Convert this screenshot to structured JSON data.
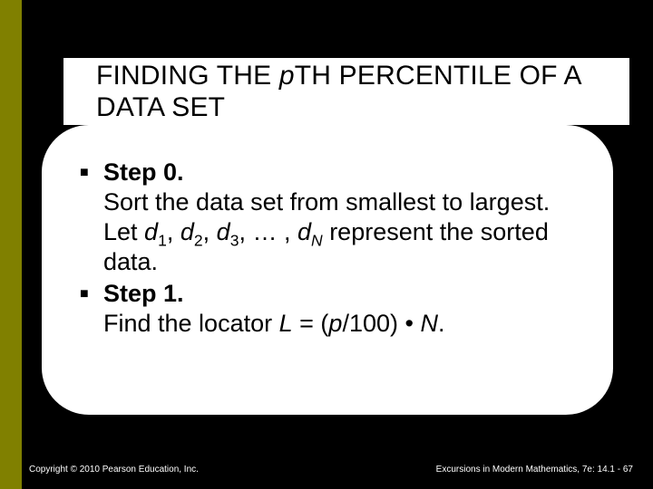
{
  "title": {
    "pre": "FINDING THE ",
    "italic": "p",
    "post": "TH PERCENTILE OF A DATA SET"
  },
  "steps": [
    {
      "label": "Step 0.",
      "body_html": "Sort the data set from smallest to largest. Let <i>d</i><sub>1</sub>, <i>d</i><sub>2</sub>, <i>d</i><sub>3</sub>, … , <i>d</i><sub><i>N</i></sub> represent the sorted data."
    },
    {
      "label": "Step 1.",
      "body_html": "Find the locator <i>L</i> = (<i>p</i>/100)&nbsp;•&nbsp;<i>N</i>."
    }
  ],
  "footer": {
    "left": "Copyright © 2010 Pearson Education, Inc.",
    "right": "Excursions in Modern Mathematics, 7e: 14.1 - 67"
  }
}
